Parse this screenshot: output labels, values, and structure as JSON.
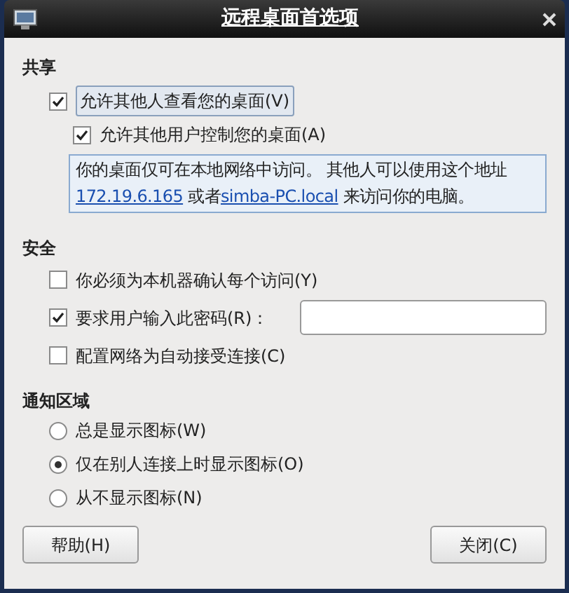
{
  "window": {
    "title": "远程桌面首选项"
  },
  "sharing": {
    "heading": "共享",
    "view": {
      "label": "允许其他人查看您的桌面(V)",
      "checked": true,
      "focused": true
    },
    "control": {
      "label": "允许其他用户控制您的桌面(A)",
      "checked": true
    },
    "info": [
      {
        "kind": "text",
        "text": "你的桌面仅可在本地网络中访问。 其他人可以使用这个地址 "
      },
      {
        "kind": "link",
        "text": "172.19.6.165"
      },
      {
        "kind": "text",
        "text": " 或者"
      },
      {
        "kind": "link",
        "text": "simba-PC.local"
      },
      {
        "kind": "text",
        "text": " 来访问你的电脑。"
      }
    ]
  },
  "security": {
    "heading": "安全",
    "options": [
      {
        "label": "你必须为本机器确认每个访问(Y)",
        "checked": false
      },
      {
        "label": "要求用户输入此密码(R)：",
        "checked": true,
        "has_field": true
      },
      {
        "label": "配置网络为自动接受连接(C)",
        "checked": false
      }
    ]
  },
  "notification": {
    "heading": "通知区域",
    "options": [
      {
        "label": "总是显示图标(W)",
        "selected": false
      },
      {
        "label": "仅在别人连接上时显示图标(O)",
        "selected": true
      },
      {
        "label": "从不显示图标(N)",
        "selected": false
      }
    ]
  },
  "buttons": [
    {
      "label": "帮助(H)"
    },
    {
      "label": "关闭(C)"
    }
  ]
}
